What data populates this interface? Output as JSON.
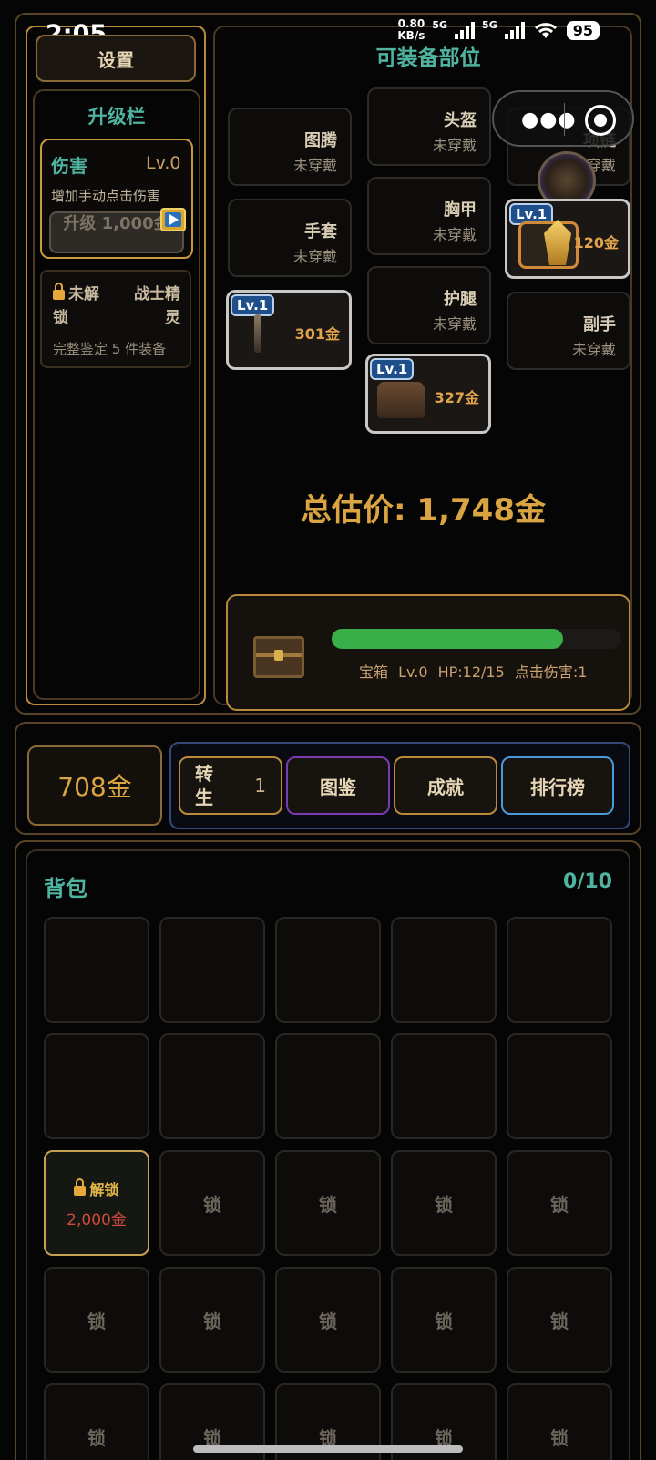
{
  "status": {
    "time": "2:05",
    "net_speed": "0.80",
    "net_unit": "KB/s",
    "sig1": "5G",
    "sig2": "5G",
    "battery": "95"
  },
  "left": {
    "settings": "设置",
    "upgrade_title": "升级栏",
    "damage_label": "伤害",
    "damage_level": "Lv.0",
    "damage_desc": "增加手动点击伤害",
    "upgrade_btn": "升级 1,000金",
    "locked_label1": "未解",
    "locked_label1b": "锁",
    "locked_label2": "战士精",
    "locked_label2b": "灵",
    "locked_desc": "完整鉴定 5 件装备"
  },
  "equip": {
    "title": "可装备部位",
    "empty_state": "未穿戴",
    "totem": "图腾",
    "helmet": "头盔",
    "necklace": "项链",
    "gloves": "手套",
    "chest": "胸甲",
    "leggings": "护腿",
    "offhand": "副手",
    "weapon_level": "Lv.1",
    "weapon_price": "301金",
    "boots_level": "Lv.1",
    "boots_price": "327金",
    "ring_level": "Lv.1",
    "ring_price": "120金"
  },
  "total_value": "总估价: 1,748金",
  "chest_box": {
    "info": "宝箱 Lv.0  HP:12/15  点击伤害:1",
    "hp": 12,
    "hp_max": 15
  },
  "gold": "708金",
  "menu": {
    "rebirth": "转生",
    "rebirth_count": "1",
    "codex": "图鉴",
    "achievements": "成就",
    "leaderboard": "排行榜"
  },
  "bag": {
    "title": "背包",
    "count": "0/10",
    "lock": "锁",
    "unlock_label": "解锁",
    "unlock_price": "2,000金"
  },
  "colors": {
    "accent_teal": "#4fb3a0",
    "gold": "#d9a441",
    "hp_green": "#3aae48"
  }
}
